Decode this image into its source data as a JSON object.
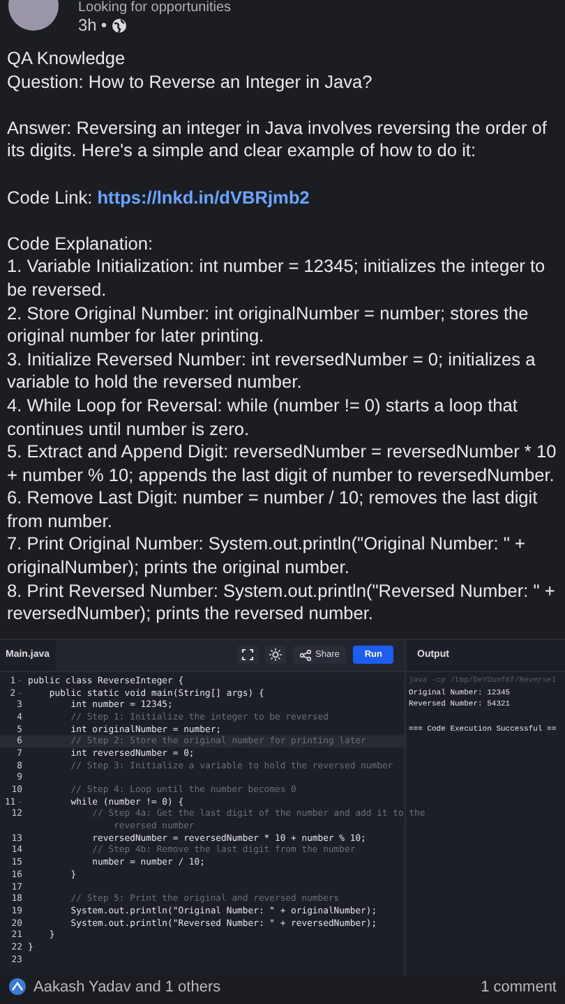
{
  "post_header": {
    "subtitle": "Looking for opportunities",
    "time": "3h",
    "separator": "•"
  },
  "post": {
    "title": "QA Knowledge",
    "question": "Question: How to Reverse an Integer in Java?",
    "answer": "Answer: Reversing an integer in Java involves reversing the order of its digits. Here's a simple and clear example of how to do it:",
    "code_link": {
      "label": "Code Link: ",
      "url": "https://lnkd.in/dVBRjmb2"
    },
    "explanation_title": "Code Explanation:",
    "explanation_items": [
      "1. Variable Initialization: int number = 12345; initializes the integer to be reversed.",
      "2. Store Original Number: int originalNumber = number; stores the original number for later printing.",
      "3. Initialize Reversed Number: int reversedNumber = 0; initializes a variable to hold the reversed number.",
      "4. While Loop for Reversal: while (number != 0) starts a loop that continues until number is zero.",
      "5. Extract and Append Digit: reversedNumber = reversedNumber * 10 + number % 10; appends the last digit of number to reversedNumber.",
      "6. Remove Last Digit: number = number / 10; removes the last digit from number.",
      "7. Print Original Number: System.out.println(\"Original Number: \" + originalNumber); prints the original number.",
      "8. Print Reversed Number: System.out.println(\"Reversed Number: \" + reversedNumber); prints the reversed number."
    ]
  },
  "editor": {
    "file_tab": "Main.java",
    "share_button": "Share",
    "run_button": "Run",
    "output_title": "Output",
    "lines": [
      {
        "num": "1",
        "marker": "-",
        "kind": "code",
        "highlighted": false,
        "text": "public class ReverseInteger {"
      },
      {
        "num": "2",
        "marker": "-",
        "kind": "code",
        "highlighted": false,
        "text": "    public static void main(String[] args) {"
      },
      {
        "num": "3",
        "kind": "code",
        "highlighted": false,
        "text": "        int number = 12345;"
      },
      {
        "num": "4",
        "kind": "comment",
        "highlighted": false,
        "text": "        // Step 1: Initialize the integer to be reversed"
      },
      {
        "num": "5",
        "kind": "code",
        "highlighted": false,
        "text": "        int originalNumber = number;"
      },
      {
        "num": "6",
        "kind": "comment",
        "highlighted": true,
        "text": "        // Step 2: Store the original number for printing later"
      },
      {
        "num": "7",
        "kind": "code",
        "highlighted": false,
        "text": "        int reversedNumber = 0;"
      },
      {
        "num": "8",
        "kind": "comment",
        "highlighted": false,
        "text": "        // Step 3: Initialize a variable to hold the reversed number"
      },
      {
        "num": "9",
        "highlighted": false
      },
      {
        "num": "10",
        "kind": "comment",
        "highlighted": false,
        "text": "        // Step 4: Loop until the number becomes 0"
      },
      {
        "num": "11",
        "marker": "-",
        "kind": "code",
        "highlighted": false,
        "text": "        while (number != 0) {"
      },
      {
        "num": "12",
        "kind": "comment",
        "highlighted": false,
        "text": "            // Step 4a: Get the last digit of the number and add it to the"
      },
      {
        "kind": "comment",
        "highlighted": false,
        "text": "                reversed number"
      },
      {
        "num": "13",
        "kind": "code",
        "highlighted": false,
        "text": "            reversedNumber = reversedNumber * 10 + number % 10;"
      },
      {
        "num": "14",
        "kind": "comment",
        "highlighted": false,
        "text": "            // Step 4b: Remove the last digit from the number"
      },
      {
        "num": "15",
        "kind": "code",
        "highlighted": false,
        "text": "            number = number / 10;"
      },
      {
        "num": "16",
        "kind": "code",
        "highlighted": false,
        "text": "        }"
      },
      {
        "num": "17",
        "highlighted": false
      },
      {
        "num": "18",
        "kind": "comment",
        "highlighted": false,
        "text": "        // Step 5: Print the original and reversed numbers"
      },
      {
        "num": "19",
        "kind": "code",
        "highlighted": false,
        "text": "        System.out.println(\"Original Number: \" + originalNumber);"
      },
      {
        "num": "20",
        "kind": "code",
        "highlighted": false,
        "text": "        System.out.println(\"Reversed Number: \" + reversedNumber);"
      },
      {
        "num": "21",
        "kind": "code",
        "highlighted": false,
        "text": "    }"
      },
      {
        "num": "22",
        "kind": "code",
        "highlighted": false,
        "text": "}"
      },
      {
        "num": "23",
        "highlighted": false
      }
    ],
    "output_lines": [
      {
        "kind": "command",
        "text": "java -cp /tmp/DeYDuof6f/ReverseI"
      },
      {
        "kind": "result",
        "text": "Original Number: 12345"
      },
      {
        "kind": "result",
        "text": "Reversed Number: 54321"
      },
      {
        "kind": "result",
        "text": "=== Code Execution Successful =="
      }
    ]
  },
  "footer": {
    "reactions": "Aakash Yadav and 1 others",
    "comments": "1 comment"
  }
}
